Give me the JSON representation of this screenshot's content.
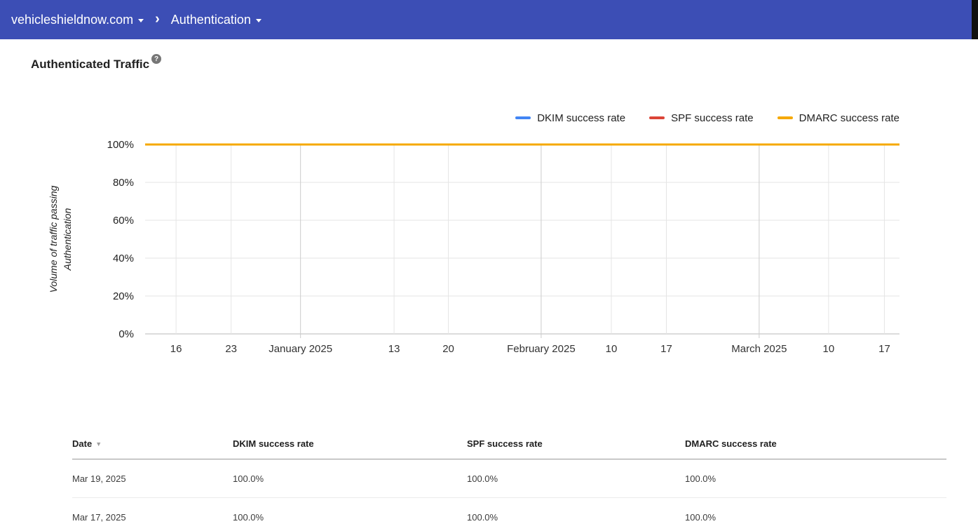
{
  "header": {
    "site_selector": "vehicleshieldnow.com",
    "separator": "›",
    "section_selector": "Authentication"
  },
  "page": {
    "title": "Authenticated Traffic",
    "help": "?"
  },
  "chart_data": {
    "type": "line",
    "title": "",
    "xlabel": "",
    "ylabel": "Volume of traffic passing Authentication",
    "ylim": [
      0,
      100
    ],
    "yticks": [
      "100%",
      "80%",
      "60%",
      "40%",
      "20%",
      "0%"
    ],
    "xticks": [
      "16",
      "23",
      "January 2025",
      "13",
      "20",
      "February 2025",
      "10",
      "17",
      "March 2025",
      "10",
      "17"
    ],
    "xtick_fractions": [
      0.041,
      0.114,
      0.206,
      0.33,
      0.402,
      0.525,
      0.618,
      0.691,
      0.814,
      0.906,
      0.98
    ],
    "major_xticks": [
      2,
      5,
      8
    ],
    "grid": true,
    "legend_position": "top-right",
    "series": [
      {
        "name": "DKIM success rate",
        "color": "#4285F4",
        "values": [
          100,
          100,
          100,
          100,
          100,
          100,
          100,
          100,
          100,
          100,
          100
        ]
      },
      {
        "name": "SPF success rate",
        "color": "#DB4437",
        "values": [
          100,
          100,
          100,
          100,
          100,
          100,
          100,
          100,
          100,
          100,
          100
        ]
      },
      {
        "name": "DMARC success rate",
        "color": "#F5A800",
        "values": [
          100,
          100,
          100,
          100,
          100,
          100,
          100,
          100,
          100,
          100,
          100
        ]
      }
    ]
  },
  "table": {
    "columns": [
      "Date",
      "DKIM success rate",
      "SPF success rate",
      "DMARC success rate"
    ],
    "sort_icon": "▼",
    "rows": [
      [
        "Mar 19, 2025",
        "100.0%",
        "100.0%",
        "100.0%"
      ],
      [
        "Mar 17, 2025",
        "100.0%",
        "100.0%",
        "100.0%"
      ]
    ]
  }
}
